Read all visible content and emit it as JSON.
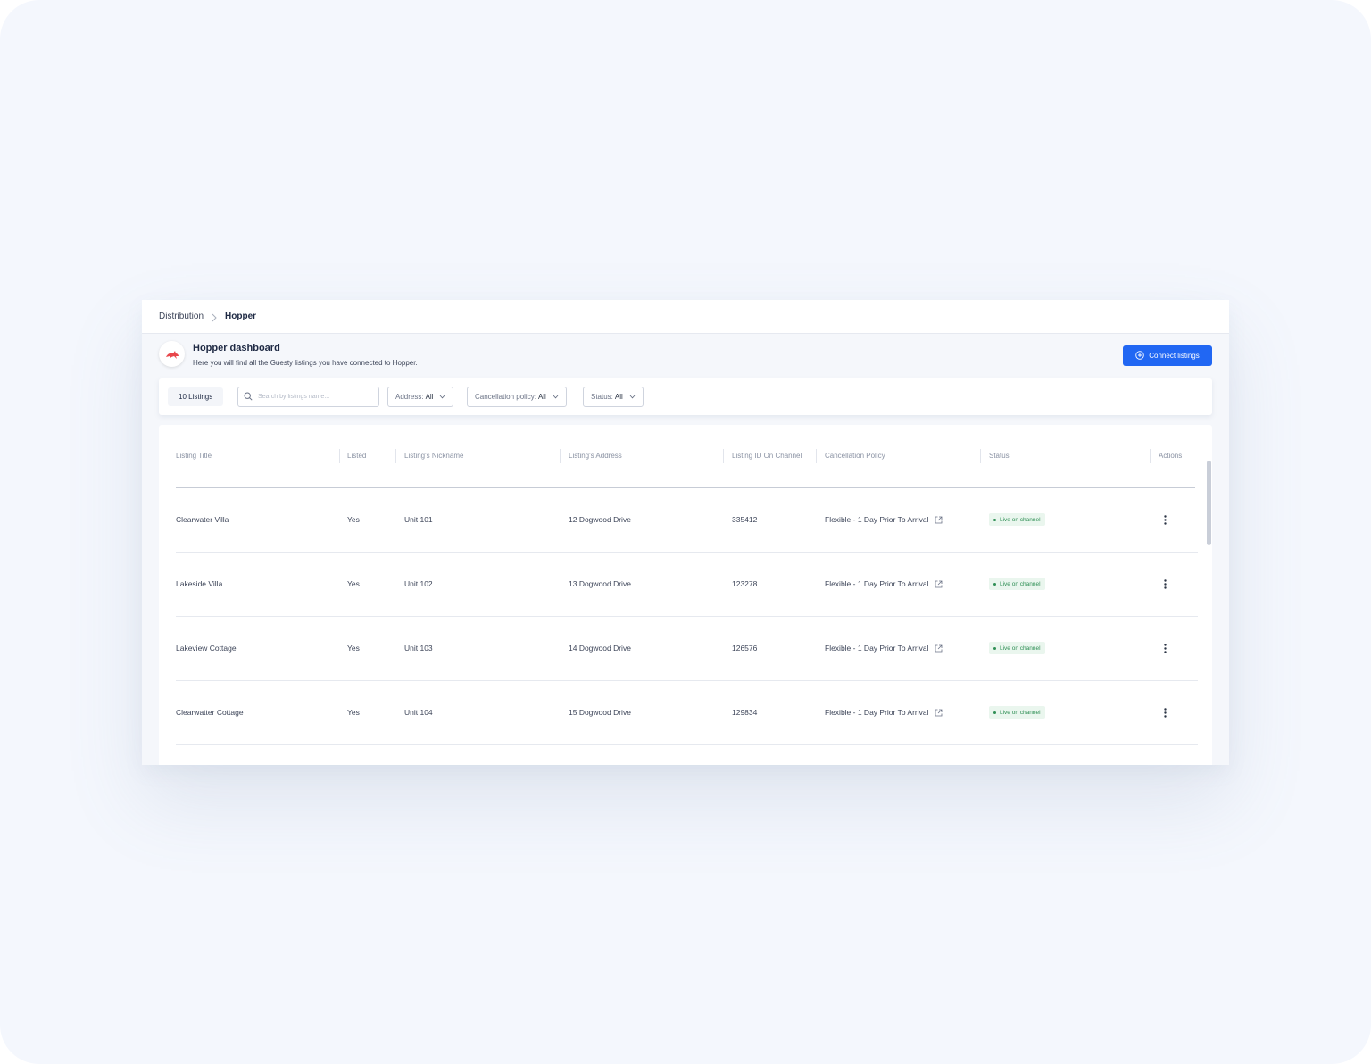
{
  "breadcrumb": {
    "root": "Distribution",
    "current": "Hopper"
  },
  "header": {
    "title": "Hopper dashboard",
    "subtitle": "Here you will find all the Guesty listings you have connected to Hopper.",
    "connect_label": "Connect listings",
    "logo_icon": "hopper-bunny-icon"
  },
  "filters": {
    "count_label": "10 Listings",
    "search_placeholder": "Search by listings name...",
    "address": {
      "label": "Address:",
      "value": "All"
    },
    "cancellation": {
      "label": "Cancellation policy:",
      "value": "All"
    },
    "status": {
      "label": "Status:",
      "value": "All"
    }
  },
  "table": {
    "columns": [
      "Listing Title",
      "Listed",
      "Listing's Nickname",
      "Listing's Address",
      "Listing ID On Channel",
      "Cancellation Policy",
      "Status",
      "Actions"
    ],
    "rows": [
      {
        "title": "Clearwater Villa",
        "listed": "Yes",
        "nickname": "Unit 101",
        "address": "12 Dogwood Drive",
        "channel_id": "335412",
        "policy": "Flexible - 1 Day Prior To Arrival",
        "status": "Live on channel"
      },
      {
        "title": "Lakeside Villa",
        "listed": "Yes",
        "nickname": "Unit 102",
        "address": "13 Dogwood Drive",
        "channel_id": "123278",
        "policy": "Flexible - 1 Day Prior To Arrival",
        "status": "Live on channel"
      },
      {
        "title": "Lakeview Cottage",
        "listed": "Yes",
        "nickname": "Unit 103",
        "address": "14 Dogwood Drive",
        "channel_id": "126576",
        "policy": "Flexible - 1 Day Prior To Arrival",
        "status": "Live on channel"
      },
      {
        "title": "Clearwatter Cottage",
        "listed": "Yes",
        "nickname": "Unit 104",
        "address": "15 Dogwood Drive",
        "channel_id": "129834",
        "policy": "Flexible - 1 Day Prior To Arrival",
        "status": "Live on channel"
      }
    ]
  },
  "colors": {
    "accent": "#2167f3",
    "status_green": "#2f8f55",
    "status_bg": "#eaf6ee",
    "logo_red": "#e8464b"
  }
}
